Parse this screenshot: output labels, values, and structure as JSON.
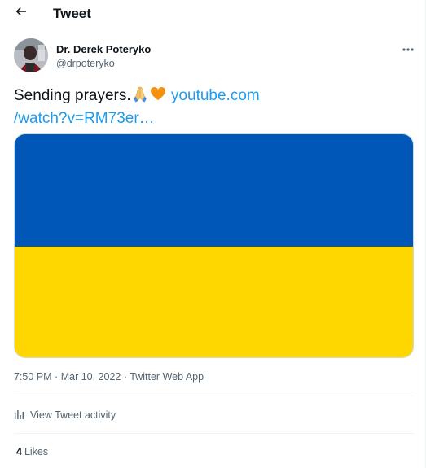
{
  "header": {
    "title": "Tweet",
    "back_icon": "arrow-left-icon"
  },
  "author": {
    "name": "Dr. Derek Poteryko",
    "handle": "@drpoteryko",
    "more_icon": "more-horizontal-icon"
  },
  "tweet": {
    "text": "Sending prayers.",
    "emojis": [
      "folded-hands-icon",
      "orange-heart-icon"
    ],
    "link_line1": "youtube.com",
    "link_line2": "/watch?v=RM73er…"
  },
  "media": {
    "description_colors": {
      "top": "#0057b7",
      "bottom": "#ffd700"
    }
  },
  "meta": {
    "time": "7:50 PM",
    "date": "Mar 10, 2022",
    "source": "Twitter Web App",
    "separator": "·"
  },
  "activity": {
    "label": "View Tweet activity",
    "icon": "bar-chart-icon"
  },
  "likes": {
    "count": "4",
    "label": "Likes"
  },
  "colors": {
    "accent": "#1d9bf0",
    "text_primary": "#0f1419",
    "text_secondary": "#536471",
    "border": "#eff3f4"
  }
}
